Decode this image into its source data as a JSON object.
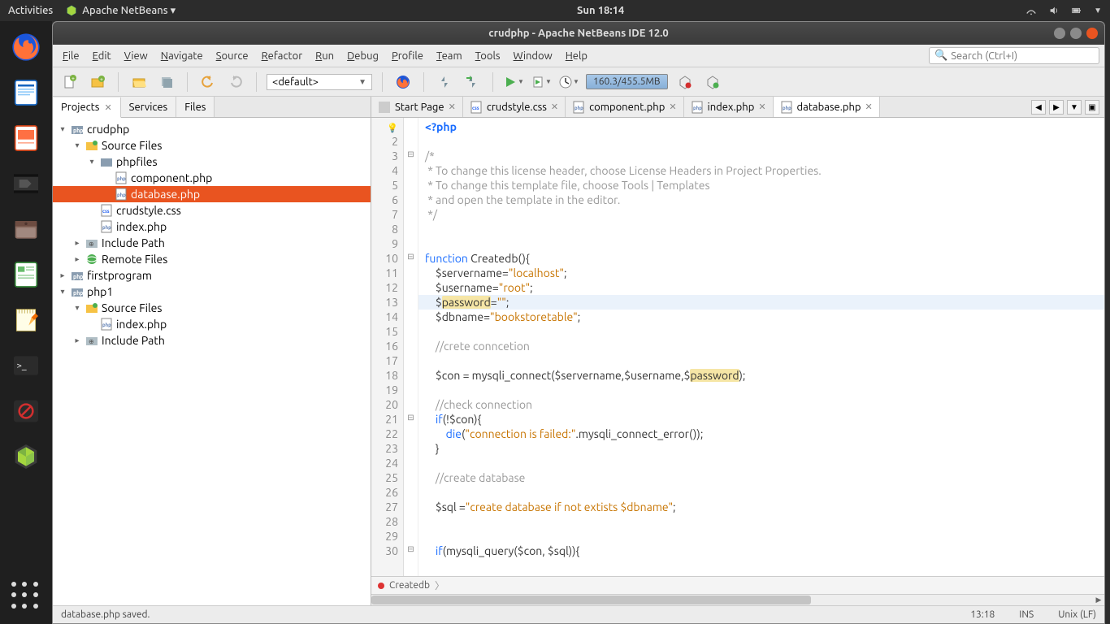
{
  "ubuntu": {
    "activities": "Activities",
    "app_label": "Apache NetBeans ▾",
    "clock": "Sun 18:14"
  },
  "window": {
    "title": "crudphp - Apache NetBeans IDE 12.0"
  },
  "menu": [
    "File",
    "Edit",
    "View",
    "Navigate",
    "Source",
    "Refactor",
    "Run",
    "Debug",
    "Profile",
    "Team",
    "Tools",
    "Window",
    "Help"
  ],
  "search_placeholder": "Search (Ctrl+I)",
  "toolbar": {
    "config": "<default>",
    "heap": "160.3/455.5MB"
  },
  "panel_tabs": [
    "Projects",
    "Services",
    "Files"
  ],
  "tree": [
    {
      "d": 0,
      "exp": "▾",
      "icon": "php-proj",
      "label": "crudphp"
    },
    {
      "d": 1,
      "exp": "▾",
      "icon": "src",
      "label": "Source Files"
    },
    {
      "d": 2,
      "exp": "▾",
      "icon": "folder",
      "label": "phpfiles"
    },
    {
      "d": 3,
      "exp": "",
      "icon": "php",
      "label": "component.php"
    },
    {
      "d": 3,
      "exp": "",
      "icon": "php",
      "label": "database.php",
      "sel": true
    },
    {
      "d": 2,
      "exp": "",
      "icon": "css",
      "label": "crudstyle.css"
    },
    {
      "d": 2,
      "exp": "",
      "icon": "php",
      "label": "index.php"
    },
    {
      "d": 1,
      "exp": "▸",
      "icon": "inc",
      "label": "Include Path"
    },
    {
      "d": 1,
      "exp": "▸",
      "icon": "remote",
      "label": "Remote Files"
    },
    {
      "d": 0,
      "exp": "▸",
      "icon": "php-proj",
      "label": "firstprogram"
    },
    {
      "d": 0,
      "exp": "▾",
      "icon": "php-proj",
      "label": "php1"
    },
    {
      "d": 1,
      "exp": "▾",
      "icon": "src",
      "label": "Source Files"
    },
    {
      "d": 2,
      "exp": "",
      "icon": "php",
      "label": "index.php"
    },
    {
      "d": 1,
      "exp": "▸",
      "icon": "inc",
      "label": "Include Path"
    }
  ],
  "editor_tabs": [
    {
      "label": "Start Page",
      "icon": "start"
    },
    {
      "label": "crudstyle.css",
      "icon": "css"
    },
    {
      "label": "component.php",
      "icon": "php"
    },
    {
      "label": "index.php",
      "icon": "php"
    },
    {
      "label": "database.php",
      "icon": "php",
      "active": true
    }
  ],
  "code_lines": [
    {
      "n": 1,
      "bulb": true,
      "html": "<span class='tag'>&lt;?php</span>"
    },
    {
      "n": 2,
      "html": ""
    },
    {
      "n": 3,
      "fold": "⊟",
      "html": "<span class='c'>/*</span>"
    },
    {
      "n": 4,
      "html": "<span class='c'> * To change this license header, choose License Headers in Project Properties.</span>"
    },
    {
      "n": 5,
      "html": "<span class='c'> * To change this template file, choose Tools | Templates</span>"
    },
    {
      "n": 6,
      "html": "<span class='c'> * and open the template in the editor.</span>"
    },
    {
      "n": 7,
      "html": "<span class='c'> */</span>"
    },
    {
      "n": 8,
      "html": ""
    },
    {
      "n": 9,
      "html": ""
    },
    {
      "n": 10,
      "fold": "⊟",
      "html": "<span class='k'>function</span> Createdb(){"
    },
    {
      "n": 11,
      "html": "    $servername=<span class='s'>\"localhost\"</span>;"
    },
    {
      "n": 12,
      "html": "    $username=<span class='s'>\"root\"</span>;"
    },
    {
      "n": 13,
      "current": true,
      "html": "    $<span class='hl'>password</span>=<span class='s'>\"\"</span>;"
    },
    {
      "n": 14,
      "html": "    $dbname=<span class='s'>\"bookstoretable\"</span>;"
    },
    {
      "n": 15,
      "html": ""
    },
    {
      "n": 16,
      "html": "    <span class='c'>//crete conncetion</span>"
    },
    {
      "n": 17,
      "html": ""
    },
    {
      "n": 18,
      "html": "    $con = mysqli_connect($servername,$username,$<span class='hl'>password</span>);"
    },
    {
      "n": 19,
      "html": ""
    },
    {
      "n": 20,
      "html": "    <span class='c'>//check connection</span>"
    },
    {
      "n": 21,
      "fold": "⊟",
      "html": "    <span class='k'>if</span>(!$con){"
    },
    {
      "n": 22,
      "html": "        <span class='k'>die</span>(<span class='s'>\"connection is failed:\"</span>.mysqli_connect_error());"
    },
    {
      "n": 23,
      "html": "    }"
    },
    {
      "n": 24,
      "html": ""
    },
    {
      "n": 25,
      "html": "    <span class='c'>//create database</span>"
    },
    {
      "n": 26,
      "html": ""
    },
    {
      "n": 27,
      "html": "    $sql =<span class='s'>\"create database if not extists $dbname\"</span>;"
    },
    {
      "n": 28,
      "html": ""
    },
    {
      "n": 29,
      "html": ""
    },
    {
      "n": 30,
      "fold": "⊟",
      "html": "    <span class='k'>if</span>(mysqli_query($con, $sql)){"
    }
  ],
  "breadcrumb": "Createdb",
  "status": {
    "msg": "database.php saved.",
    "pos": "13:18",
    "mode": "INS",
    "enc": "Unix (LF)"
  }
}
